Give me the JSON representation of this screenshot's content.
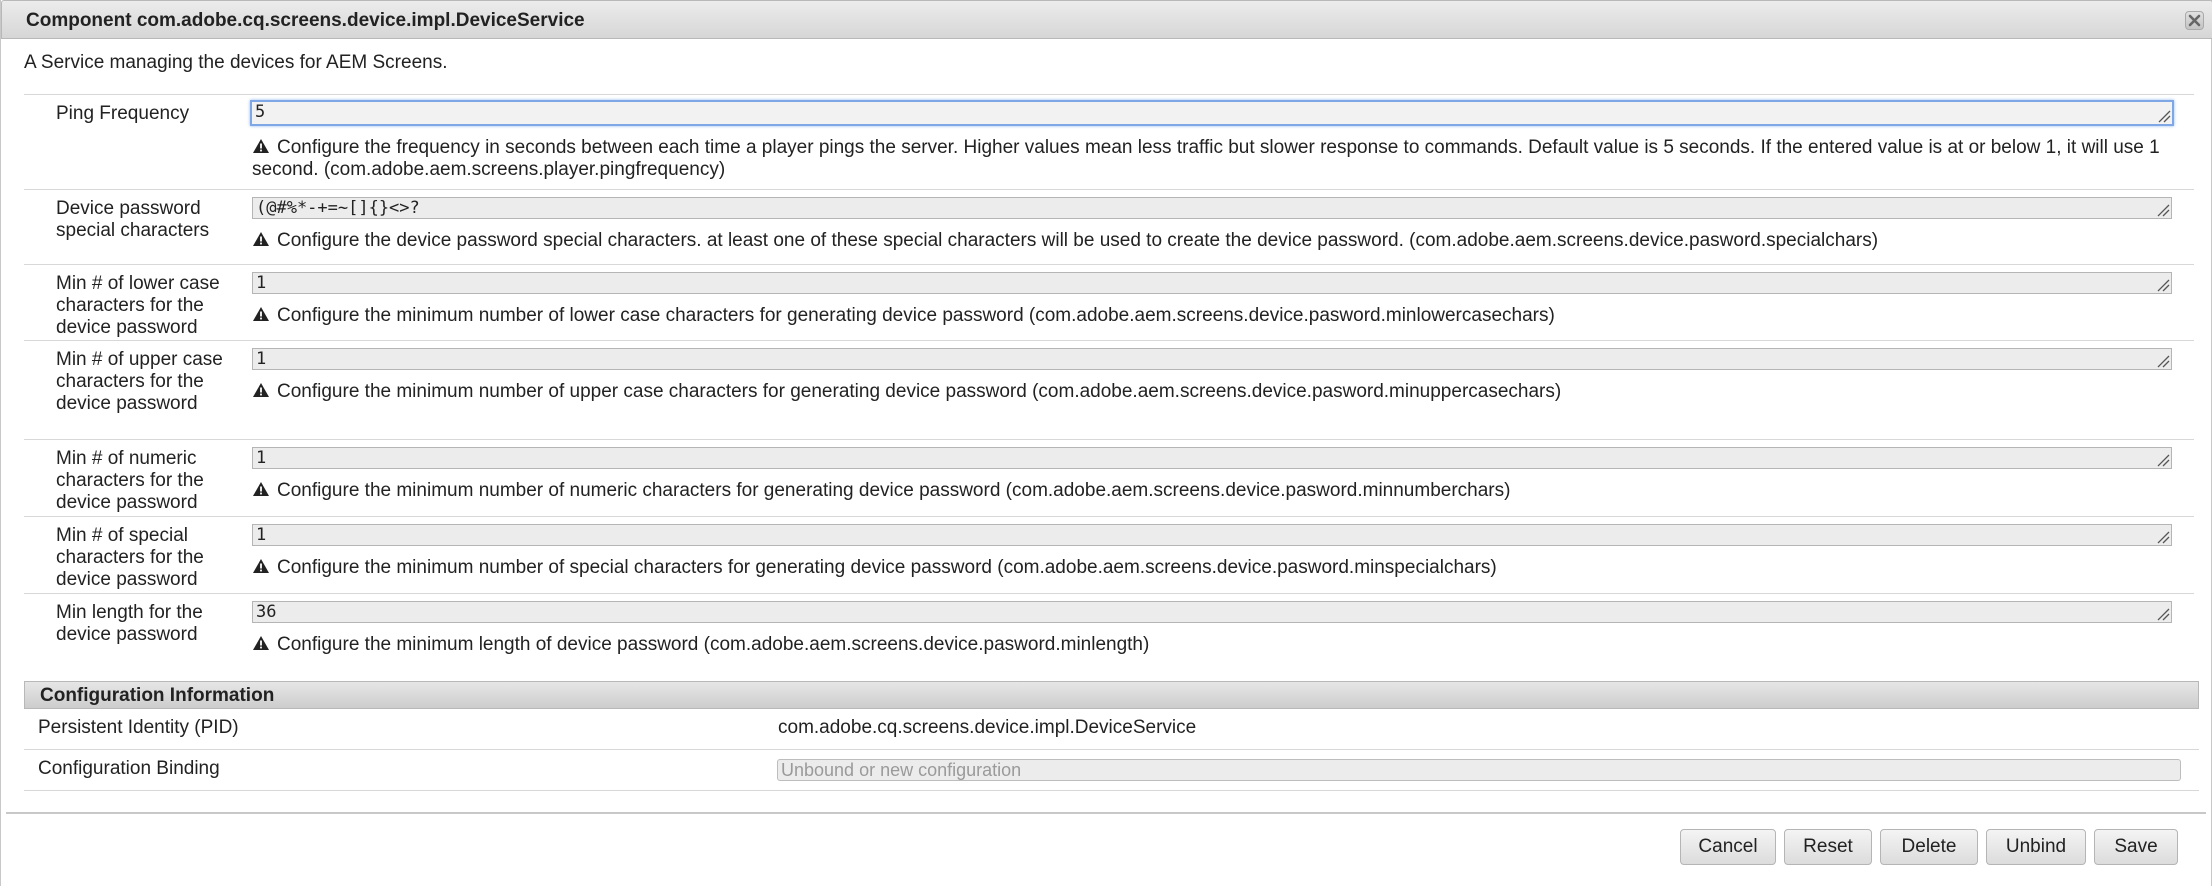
{
  "dialog": {
    "title": "Component com.adobe.cq.screens.device.impl.DeviceService",
    "close_icon": "close-icon",
    "description": "A Service managing the devices for AEM Screens."
  },
  "properties": [
    {
      "label": "Ping Frequency",
      "value": "5",
      "focused": true,
      "hint": "Configure the frequency in seconds between each time a player pings the server. Higher values mean less traffic but slower response to commands. Default value is 5 seconds. If the entered value is at or below 1, it will use 1 second. (com.adobe.aem.screens.player.pingfrequency)"
    },
    {
      "label": "Device password special characters",
      "value": "(@#%*-+=~[]{}<>?",
      "hint": "Configure the device password special characters. at least one of these special characters will be used to create the device password. (com.adobe.aem.screens.device.pasword.specialchars)"
    },
    {
      "label": "Min # of lower case characters for the device password",
      "value": "1",
      "hint": "Configure the minimum number of lower case characters for generating device password (com.adobe.aem.screens.device.pasword.minlowercasechars)"
    },
    {
      "label": "Min # of upper case characters for the device password",
      "value": "1",
      "hint": "Configure the minimum number of upper case characters for generating device password (com.adobe.aem.screens.device.pasword.minuppercasechars)"
    },
    {
      "label": "Min # of numeric characters for the device password",
      "value": "1",
      "hint": "Configure the minimum number of numeric characters for generating device password (com.adobe.aem.screens.device.pasword.minnumberchars)"
    },
    {
      "label": "Min # of special characters for the device password",
      "value": "1",
      "hint": "Configure the minimum number of special characters for generating device password (com.adobe.aem.screens.device.pasword.minspecialchars)"
    },
    {
      "label": "Min length for the device password",
      "value": "36",
      "hint": "Configure the minimum length of device password (com.adobe.aem.screens.device.pasword.minlength)"
    }
  ],
  "config_info": {
    "header": "Configuration Information",
    "pid_label": "Persistent Identity (PID)",
    "pid_value": "com.adobe.cq.screens.device.impl.DeviceService",
    "binding_label": "Configuration Binding",
    "binding_placeholder": "Unbound or new configuration"
  },
  "buttons": {
    "cancel": "Cancel",
    "reset": "Reset",
    "delete": "Delete",
    "unbind": "Unbind",
    "save": "Save"
  },
  "icons": {
    "hint_icon": "warning-icon",
    "resize_icon": "resize-grip-icon"
  },
  "colors": {
    "focus_border": "#7fa7e6",
    "field_bg": "#ececec",
    "header_bg": "#d6d6d6"
  }
}
